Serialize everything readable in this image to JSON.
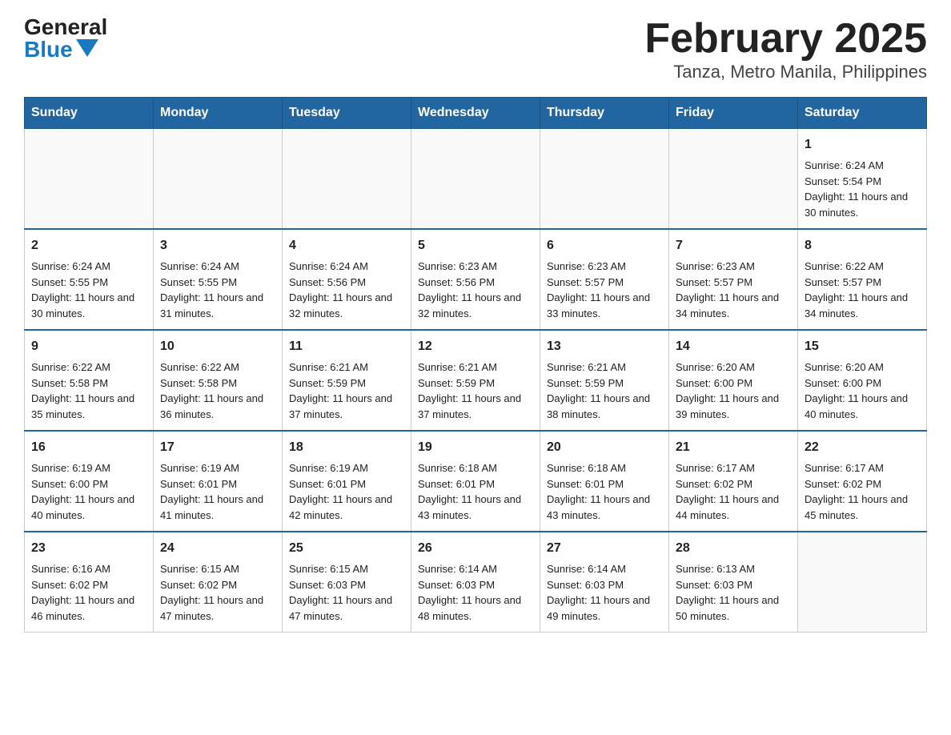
{
  "logo": {
    "general": "General",
    "blue": "Blue"
  },
  "title": "February 2025",
  "subtitle": "Tanza, Metro Manila, Philippines",
  "days": [
    "Sunday",
    "Monday",
    "Tuesday",
    "Wednesday",
    "Thursday",
    "Friday",
    "Saturday"
  ],
  "weeks": [
    [
      {
        "day": "",
        "info": ""
      },
      {
        "day": "",
        "info": ""
      },
      {
        "day": "",
        "info": ""
      },
      {
        "day": "",
        "info": ""
      },
      {
        "day": "",
        "info": ""
      },
      {
        "day": "",
        "info": ""
      },
      {
        "day": "1",
        "info": "Sunrise: 6:24 AM\nSunset: 5:54 PM\nDaylight: 11 hours and 30 minutes."
      }
    ],
    [
      {
        "day": "2",
        "info": "Sunrise: 6:24 AM\nSunset: 5:55 PM\nDaylight: 11 hours and 30 minutes."
      },
      {
        "day": "3",
        "info": "Sunrise: 6:24 AM\nSunset: 5:55 PM\nDaylight: 11 hours and 31 minutes."
      },
      {
        "day": "4",
        "info": "Sunrise: 6:24 AM\nSunset: 5:56 PM\nDaylight: 11 hours and 32 minutes."
      },
      {
        "day": "5",
        "info": "Sunrise: 6:23 AM\nSunset: 5:56 PM\nDaylight: 11 hours and 32 minutes."
      },
      {
        "day": "6",
        "info": "Sunrise: 6:23 AM\nSunset: 5:57 PM\nDaylight: 11 hours and 33 minutes."
      },
      {
        "day": "7",
        "info": "Sunrise: 6:23 AM\nSunset: 5:57 PM\nDaylight: 11 hours and 34 minutes."
      },
      {
        "day": "8",
        "info": "Sunrise: 6:22 AM\nSunset: 5:57 PM\nDaylight: 11 hours and 34 minutes."
      }
    ],
    [
      {
        "day": "9",
        "info": "Sunrise: 6:22 AM\nSunset: 5:58 PM\nDaylight: 11 hours and 35 minutes."
      },
      {
        "day": "10",
        "info": "Sunrise: 6:22 AM\nSunset: 5:58 PM\nDaylight: 11 hours and 36 minutes."
      },
      {
        "day": "11",
        "info": "Sunrise: 6:21 AM\nSunset: 5:59 PM\nDaylight: 11 hours and 37 minutes."
      },
      {
        "day": "12",
        "info": "Sunrise: 6:21 AM\nSunset: 5:59 PM\nDaylight: 11 hours and 37 minutes."
      },
      {
        "day": "13",
        "info": "Sunrise: 6:21 AM\nSunset: 5:59 PM\nDaylight: 11 hours and 38 minutes."
      },
      {
        "day": "14",
        "info": "Sunrise: 6:20 AM\nSunset: 6:00 PM\nDaylight: 11 hours and 39 minutes."
      },
      {
        "day": "15",
        "info": "Sunrise: 6:20 AM\nSunset: 6:00 PM\nDaylight: 11 hours and 40 minutes."
      }
    ],
    [
      {
        "day": "16",
        "info": "Sunrise: 6:19 AM\nSunset: 6:00 PM\nDaylight: 11 hours and 40 minutes."
      },
      {
        "day": "17",
        "info": "Sunrise: 6:19 AM\nSunset: 6:01 PM\nDaylight: 11 hours and 41 minutes."
      },
      {
        "day": "18",
        "info": "Sunrise: 6:19 AM\nSunset: 6:01 PM\nDaylight: 11 hours and 42 minutes."
      },
      {
        "day": "19",
        "info": "Sunrise: 6:18 AM\nSunset: 6:01 PM\nDaylight: 11 hours and 43 minutes."
      },
      {
        "day": "20",
        "info": "Sunrise: 6:18 AM\nSunset: 6:01 PM\nDaylight: 11 hours and 43 minutes."
      },
      {
        "day": "21",
        "info": "Sunrise: 6:17 AM\nSunset: 6:02 PM\nDaylight: 11 hours and 44 minutes."
      },
      {
        "day": "22",
        "info": "Sunrise: 6:17 AM\nSunset: 6:02 PM\nDaylight: 11 hours and 45 minutes."
      }
    ],
    [
      {
        "day": "23",
        "info": "Sunrise: 6:16 AM\nSunset: 6:02 PM\nDaylight: 11 hours and 46 minutes."
      },
      {
        "day": "24",
        "info": "Sunrise: 6:15 AM\nSunset: 6:02 PM\nDaylight: 11 hours and 47 minutes."
      },
      {
        "day": "25",
        "info": "Sunrise: 6:15 AM\nSunset: 6:03 PM\nDaylight: 11 hours and 47 minutes."
      },
      {
        "day": "26",
        "info": "Sunrise: 6:14 AM\nSunset: 6:03 PM\nDaylight: 11 hours and 48 minutes."
      },
      {
        "day": "27",
        "info": "Sunrise: 6:14 AM\nSunset: 6:03 PM\nDaylight: 11 hours and 49 minutes."
      },
      {
        "day": "28",
        "info": "Sunrise: 6:13 AM\nSunset: 6:03 PM\nDaylight: 11 hours and 50 minutes."
      },
      {
        "day": "",
        "info": ""
      }
    ]
  ]
}
